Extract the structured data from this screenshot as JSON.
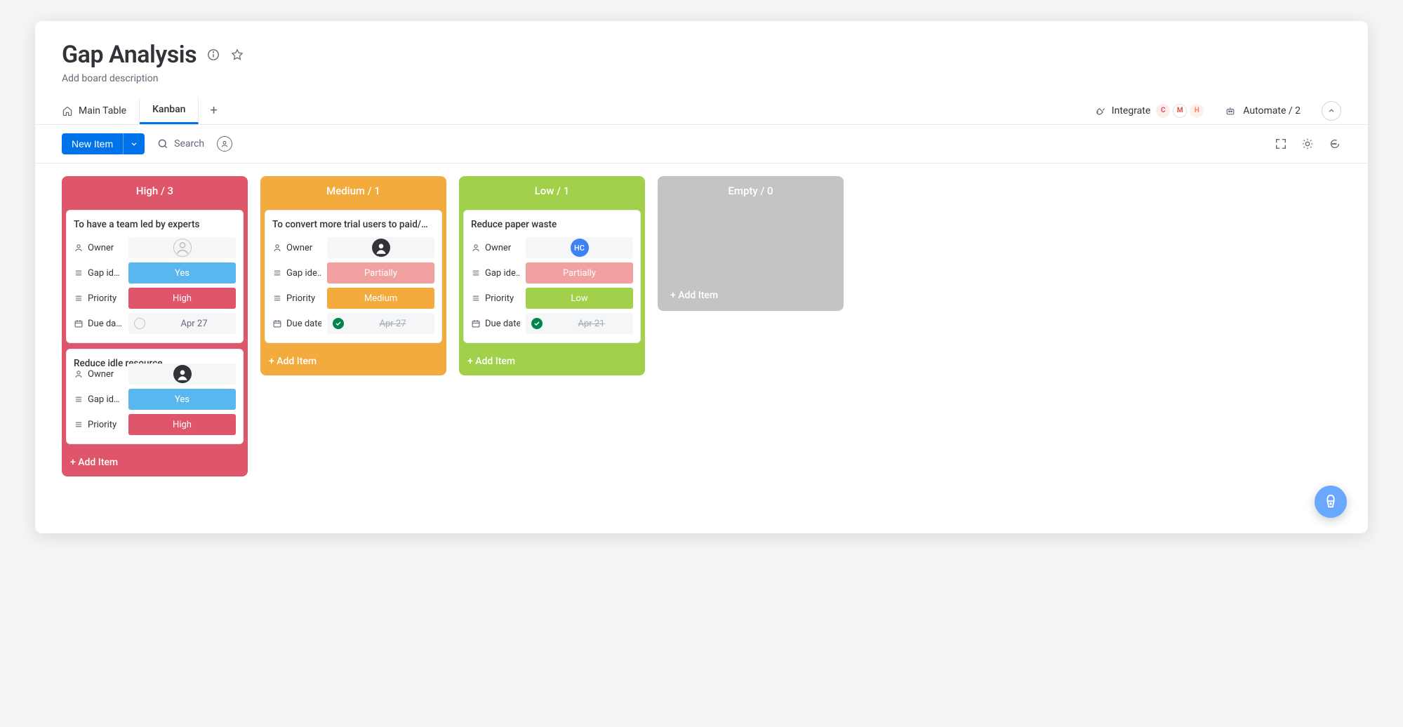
{
  "board": {
    "title": "Gap Analysis",
    "subtitle": "Add board description"
  },
  "tabs": {
    "main": "Main Table",
    "kanban": "Kanban"
  },
  "actions": {
    "integrate": "Integrate",
    "automate_label": "Automate / 2",
    "new_item": "New Item",
    "search_placeholder": "Search"
  },
  "labels": {
    "owner": "Owner",
    "gap": "Gap id…",
    "gap2": "Gap ide…",
    "priority": "Priority",
    "due_short": "Due da…",
    "due": "Due date",
    "add_item": "+ Add Item",
    "avatar_hc": "HC"
  },
  "columns": {
    "high": {
      "title": "High / 3",
      "accent": "#df5569"
    },
    "med": {
      "title": "Medium / 1",
      "accent": "#f2ab3c"
    },
    "low": {
      "title": "Low / 1",
      "accent": "#a1d04a"
    },
    "empty": {
      "title": "Empty / 0",
      "accent": "#c4c4c4"
    }
  },
  "cards": {
    "high": [
      {
        "title": "To have a team led by experts",
        "owner_type": "empty",
        "gap": {
          "value": "Yes",
          "class": "fv-yes"
        },
        "priority": {
          "value": "High",
          "class": "fv-high"
        },
        "due": {
          "value": "Apr 27",
          "done": false
        }
      },
      {
        "title": "Reduce idle resource",
        "owner_type": "filled",
        "gap": {
          "value": "Yes",
          "class": "fv-yes"
        },
        "priority": {
          "value": "High",
          "class": "fv-high"
        },
        "due": null
      }
    ],
    "med": [
      {
        "title": "To convert more trial users to paid/…",
        "owner_type": "filled",
        "gap": {
          "value": "Partially",
          "class": "fv-partial"
        },
        "priority": {
          "value": "Medium",
          "class": "fv-med"
        },
        "due": {
          "value": "Apr 27",
          "done": true
        }
      }
    ],
    "low": [
      {
        "title": "Reduce paper waste",
        "owner_type": "hc",
        "gap": {
          "value": "Partially",
          "class": "fv-partial"
        },
        "priority": {
          "value": "Low",
          "class": "fv-low"
        },
        "due": {
          "value": "Apr 21",
          "done": true
        }
      }
    ]
  }
}
